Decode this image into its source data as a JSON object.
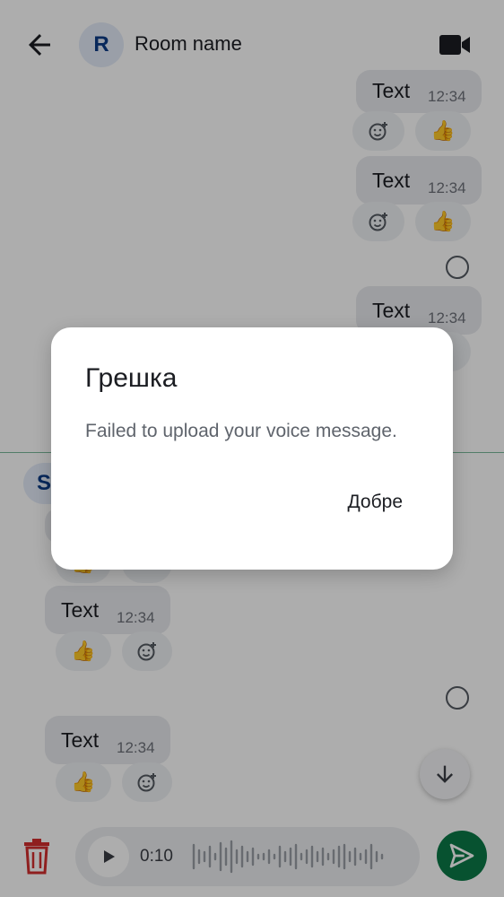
{
  "header": {
    "avatar_letter": "R",
    "room_name": "Room name"
  },
  "messages": {
    "out_1": {
      "text": "Text",
      "time": "12:34",
      "reaction": "👍"
    },
    "out_2": {
      "text": "Text",
      "time": "12:34",
      "reaction": "👍"
    },
    "out_3": {
      "text": "Text",
      "time": "12:34"
    },
    "in_sender_letter": "S",
    "in_1": {
      "reaction": "👍"
    },
    "in_2": {
      "text": "Text",
      "time": "12:34",
      "reaction": "👍"
    },
    "in_3": {
      "text": "Text",
      "time": "12:34",
      "reaction": "👍"
    }
  },
  "composer": {
    "duration": "0:10"
  },
  "dialog": {
    "title": "Грешка",
    "message": "Failed to upload your voice message.",
    "ok_label": "Добре"
  },
  "colors": {
    "accent_green": "#0b7a48",
    "delete_red": "#d32f2f",
    "avatar_bg": "#e3ebf8",
    "avatar_text": "#0d3b86"
  },
  "icons": [
    "back-arrow-icon",
    "video-call-icon",
    "add-reaction-icon",
    "thumbs-up-icon",
    "read-receipt-icon",
    "arrow-down-icon",
    "trash-icon",
    "play-icon",
    "waveform-icon",
    "send-icon"
  ]
}
